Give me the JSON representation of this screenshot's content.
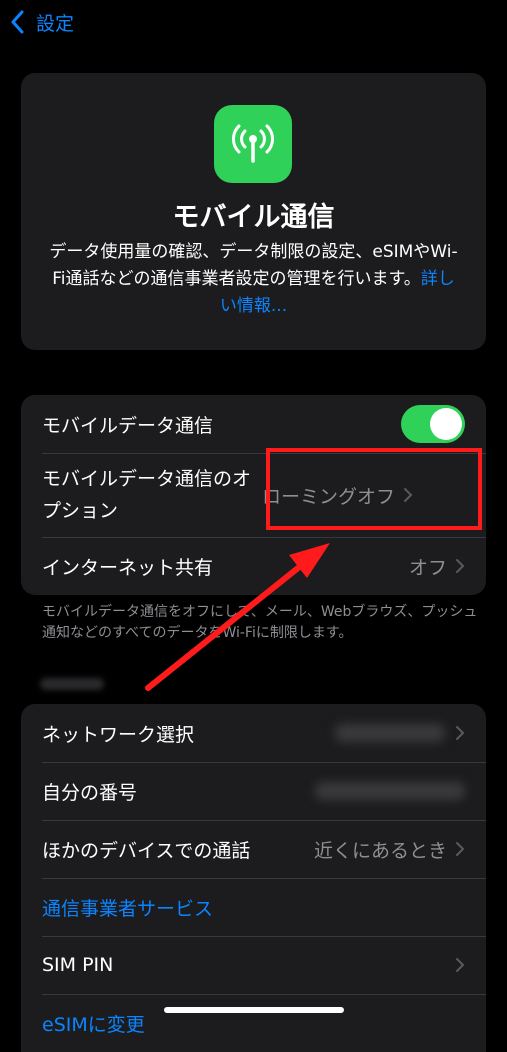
{
  "nav": {
    "back_label": "設定"
  },
  "hero": {
    "icon": "antenna-icon",
    "title": "モバイル通信",
    "description": "データ使用量の確認、データ制限の設定、eSIMやWi-Fi通話などの通信事業者設定の管理を行います。",
    "link": "詳しい情報..."
  },
  "group1": {
    "mobile_data": {
      "label": "モバイルデータ通信",
      "toggle_on": true
    },
    "data_options": {
      "label": "モバイルデータ通信のオプション",
      "value": "ローミングオフ"
    },
    "hotspot": {
      "label": "インターネット共有",
      "value": "オフ"
    }
  },
  "footnote": "モバイルデータ通信をオフにして、メール、Webブラウズ、プッシュ通知などのすべてのデータをWi-Fiに制限します。",
  "group2": {
    "network_selection": {
      "label": "ネットワーク選択"
    },
    "my_number": {
      "label": "自分の番号"
    },
    "other_devices": {
      "label": "ほかのデバイスでの通話",
      "value": "近くにあるとき"
    },
    "carrier_services": {
      "label": "通信事業者サービス"
    },
    "sim_pin": {
      "label": "SIM PIN"
    },
    "esim": {
      "label": "eSIMに変更"
    }
  },
  "colors": {
    "accent": "#0a84ff",
    "toggle_on": "#30d158",
    "annotation": "#ff1b1b"
  }
}
